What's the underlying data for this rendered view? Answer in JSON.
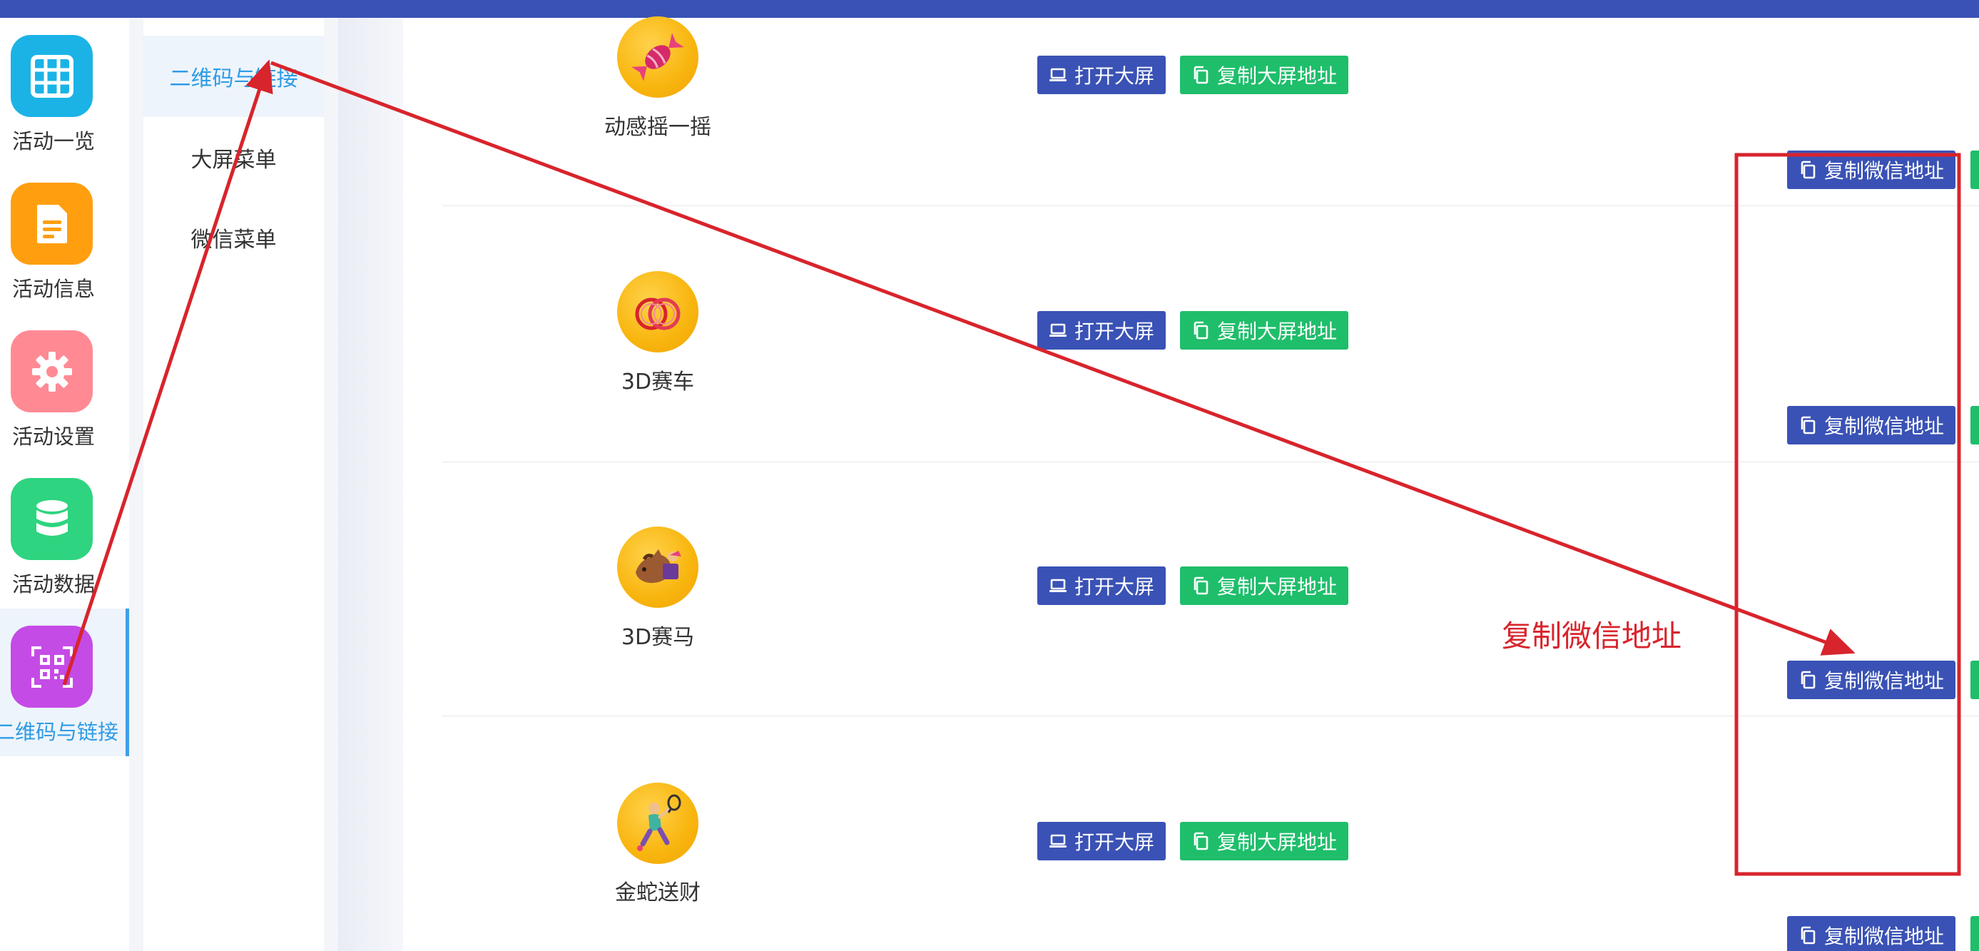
{
  "nav": {
    "items": [
      {
        "label": "活动一览",
        "icon": "grid-icon",
        "color": "#1bb3e6"
      },
      {
        "label": "活动信息",
        "icon": "document-icon",
        "color": "#ff9f0f"
      },
      {
        "label": "活动设置",
        "icon": "gear-icon",
        "color": "#ff8a94"
      },
      {
        "label": "活动数据",
        "icon": "database-icon",
        "color": "#2ed47f"
      },
      {
        "label": "二维码与链接",
        "icon": "qrcode-icon",
        "color": "#c54be6"
      }
    ],
    "active_index": 4
  },
  "submenu": {
    "items": [
      "二维码与链接",
      "大屏菜单",
      "微信菜单"
    ],
    "active_index": 0
  },
  "games": [
    {
      "name": "动感摇一摇",
      "icon": "candy-icon"
    },
    {
      "name": "3D赛车",
      "icon": "rings-icon"
    },
    {
      "name": "3D赛马",
      "icon": "horse-icon"
    },
    {
      "name": "金蛇送财",
      "icon": "tennis-player-icon"
    }
  ],
  "buttons": {
    "open_screen": "打开大屏",
    "copy_screen_url": "复制大屏地址",
    "copy_wechat_url": "复制微信地址"
  },
  "annotation": {
    "label": "复制微信地址",
    "color": "#d8242c"
  },
  "colors": {
    "primary": "#3a52b5",
    "success": "#1fbe6b",
    "active_text": "#2e9ce6"
  }
}
